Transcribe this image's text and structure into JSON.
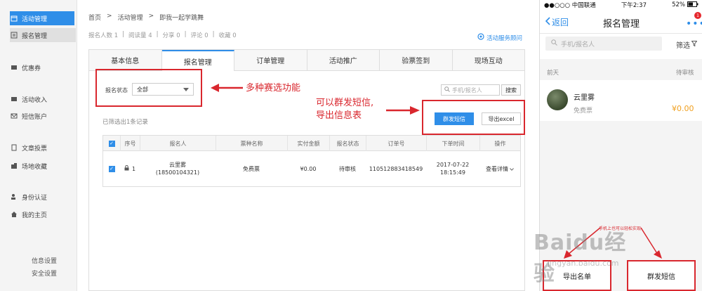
{
  "sidebar": {
    "items": [
      {
        "label": "活动管理",
        "icon": "calendar-icon"
      },
      {
        "label": "报名管理",
        "icon": "list-icon"
      },
      {
        "label": "优惠券",
        "icon": "coupon-icon"
      },
      {
        "label": "活动收入",
        "icon": "wallet-icon"
      },
      {
        "label": "短信账户",
        "icon": "mail-icon"
      },
      {
        "label": "文章投票",
        "icon": "document-icon"
      },
      {
        "label": "场地收藏",
        "icon": "building-icon"
      },
      {
        "label": "身份认证",
        "icon": "id-card-icon"
      },
      {
        "label": "我的主页",
        "icon": "home-icon"
      }
    ],
    "bottom": [
      "信息设置",
      "安全设置"
    ]
  },
  "breadcrumb": [
    "首页",
    "活动管理",
    "即我一起学跳舞"
  ],
  "stats": [
    "报名人数 1",
    "阅读量 4",
    "分享 0",
    "评论 0",
    "收藏 0"
  ],
  "service_link": "活动服务顾问",
  "tabs": [
    "基本信息",
    "报名管理",
    "订单管理",
    "活动推广",
    "验票签到",
    "现场互动"
  ],
  "filter": {
    "label": "报名状态",
    "value": "全部"
  },
  "annotations": {
    "filter_note": "多种赛选功能",
    "action_note_line1": "可以群发短信,",
    "action_note_line2": "导出信息表"
  },
  "search": {
    "placeholder": "手机/报名人",
    "button": "搜索"
  },
  "actions": {
    "sms": "群发短信",
    "export": "导出excel"
  },
  "result_count": "已筛选出1条记录",
  "table": {
    "headers": [
      "序号",
      "报名人",
      "票种名称",
      "实付金额",
      "报名状态",
      "订单号",
      "下单时间",
      "操作"
    ],
    "row": {
      "index": "1",
      "name": "云里雾",
      "phone": "(18500104321)",
      "ticket": "免费票",
      "amount": "¥0.00",
      "status": "待审核",
      "order_no": "110512883418549",
      "date": "2017-07-22",
      "time": "18:15:49",
      "action": "查看详情"
    }
  },
  "phone": {
    "status_bar": {
      "carrier": "●●○○○ 中国联通",
      "time": "下午2:37",
      "battery": "52%"
    },
    "nav": {
      "back": "返回",
      "title": "报名管理",
      "badge": "1"
    },
    "search_placeholder": "手机/报名人",
    "filter_label": "筛选",
    "section_day": "前天",
    "section_status": "待审核",
    "entry": {
      "name": "云里雾",
      "ticket": "免费票",
      "price": "¥0.00"
    },
    "hint": "手机上也可以轻松实现",
    "export_button": "导出名单",
    "sms_button": "群发短信"
  },
  "watermark": {
    "main": "Baidu经验",
    "sub": "jingyan.baidu.com"
  },
  "colors": {
    "accent": "#2f8ee8",
    "annotation_red": "#d9272e",
    "price_orange": "#f0a020"
  }
}
